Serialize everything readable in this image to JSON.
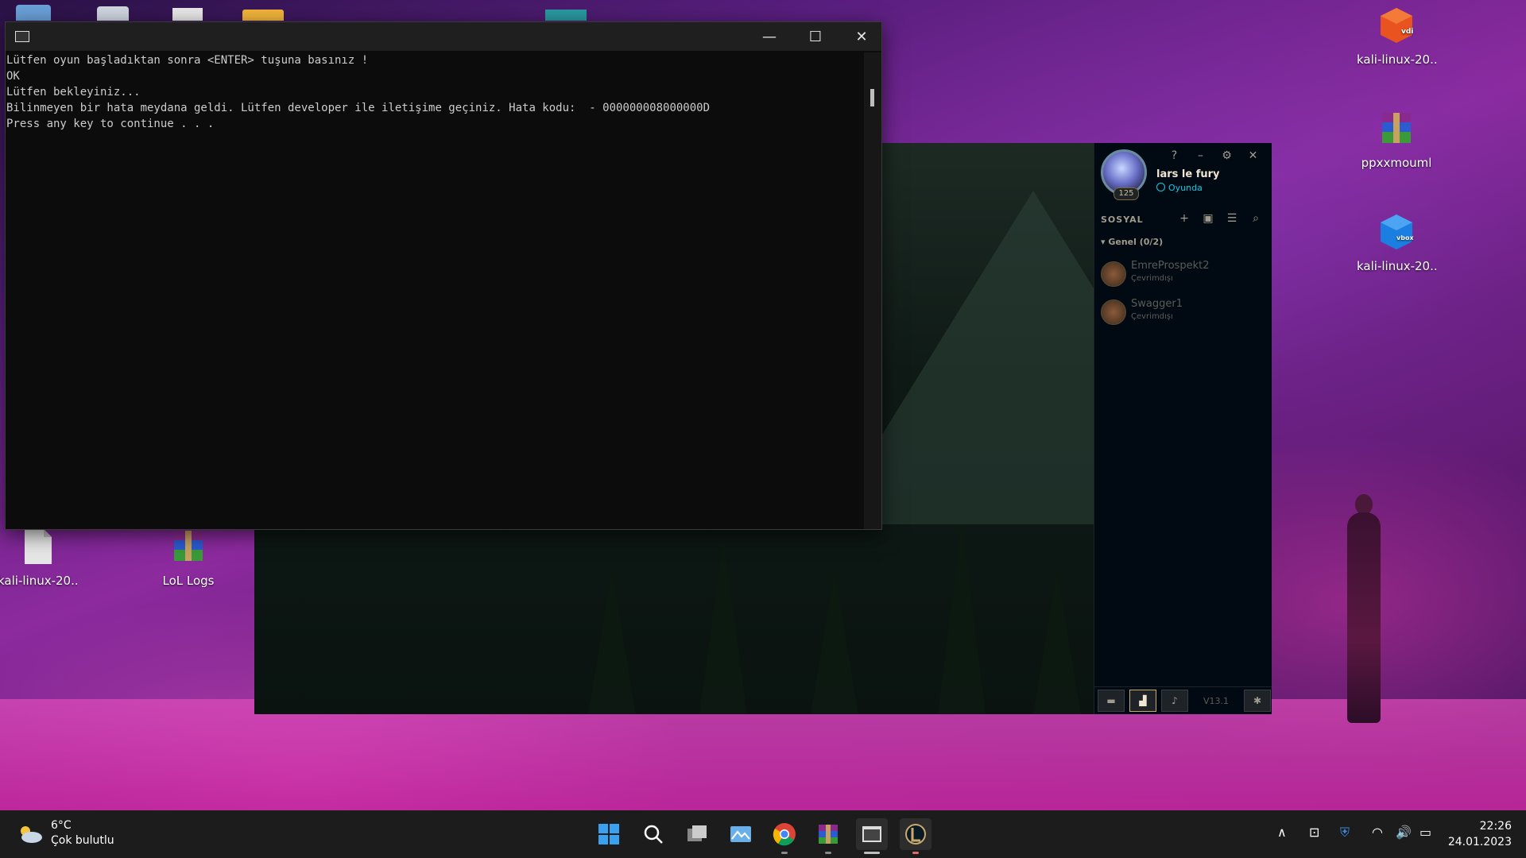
{
  "desktop": {
    "icons": [
      {
        "label": "kali-linux-20...",
        "icon": "vdi-file-icon"
      },
      {
        "label": "ppxxmouml",
        "icon": "winrar-archive-icon"
      },
      {
        "label": "kali-linux-20...",
        "icon": "vbox-file-icon"
      },
      {
        "label": "kali-linux-20...",
        "icon": "file-icon"
      },
      {
        "label": "LoL Logs",
        "icon": "winrar-archive-icon"
      }
    ]
  },
  "console": {
    "lines": [
      "Lütfen oyun başladıktan sonra <ENTER> tuşuna basınız !",
      "OK",
      "Lütfen bekleyiniz...",
      "Bilinmeyen bir hata meydana geldi. Lütfen developer ile iletişime geçiniz. Hata kodu:  - 000000008000000D",
      "Press any key to continue . . ."
    ]
  },
  "lol_client": {
    "summoner": {
      "name": "lars le fury",
      "status": "Oyunda",
      "level": "125"
    },
    "social_title": "SOSYAL",
    "group": "Genel (0/2)",
    "friends": [
      {
        "name": "EmreProspekt2",
        "status": "Çevrimdışı"
      },
      {
        "name": "Swagger1",
        "status": "Çevrimdışı"
      }
    ],
    "version": "V13.1",
    "status_color": "#0acbe6"
  },
  "taskbar": {
    "weather": {
      "temp": "6°C",
      "desc": "Çok bulutlu"
    },
    "clock": {
      "time": "22:26",
      "date": "24.01.2023"
    }
  }
}
